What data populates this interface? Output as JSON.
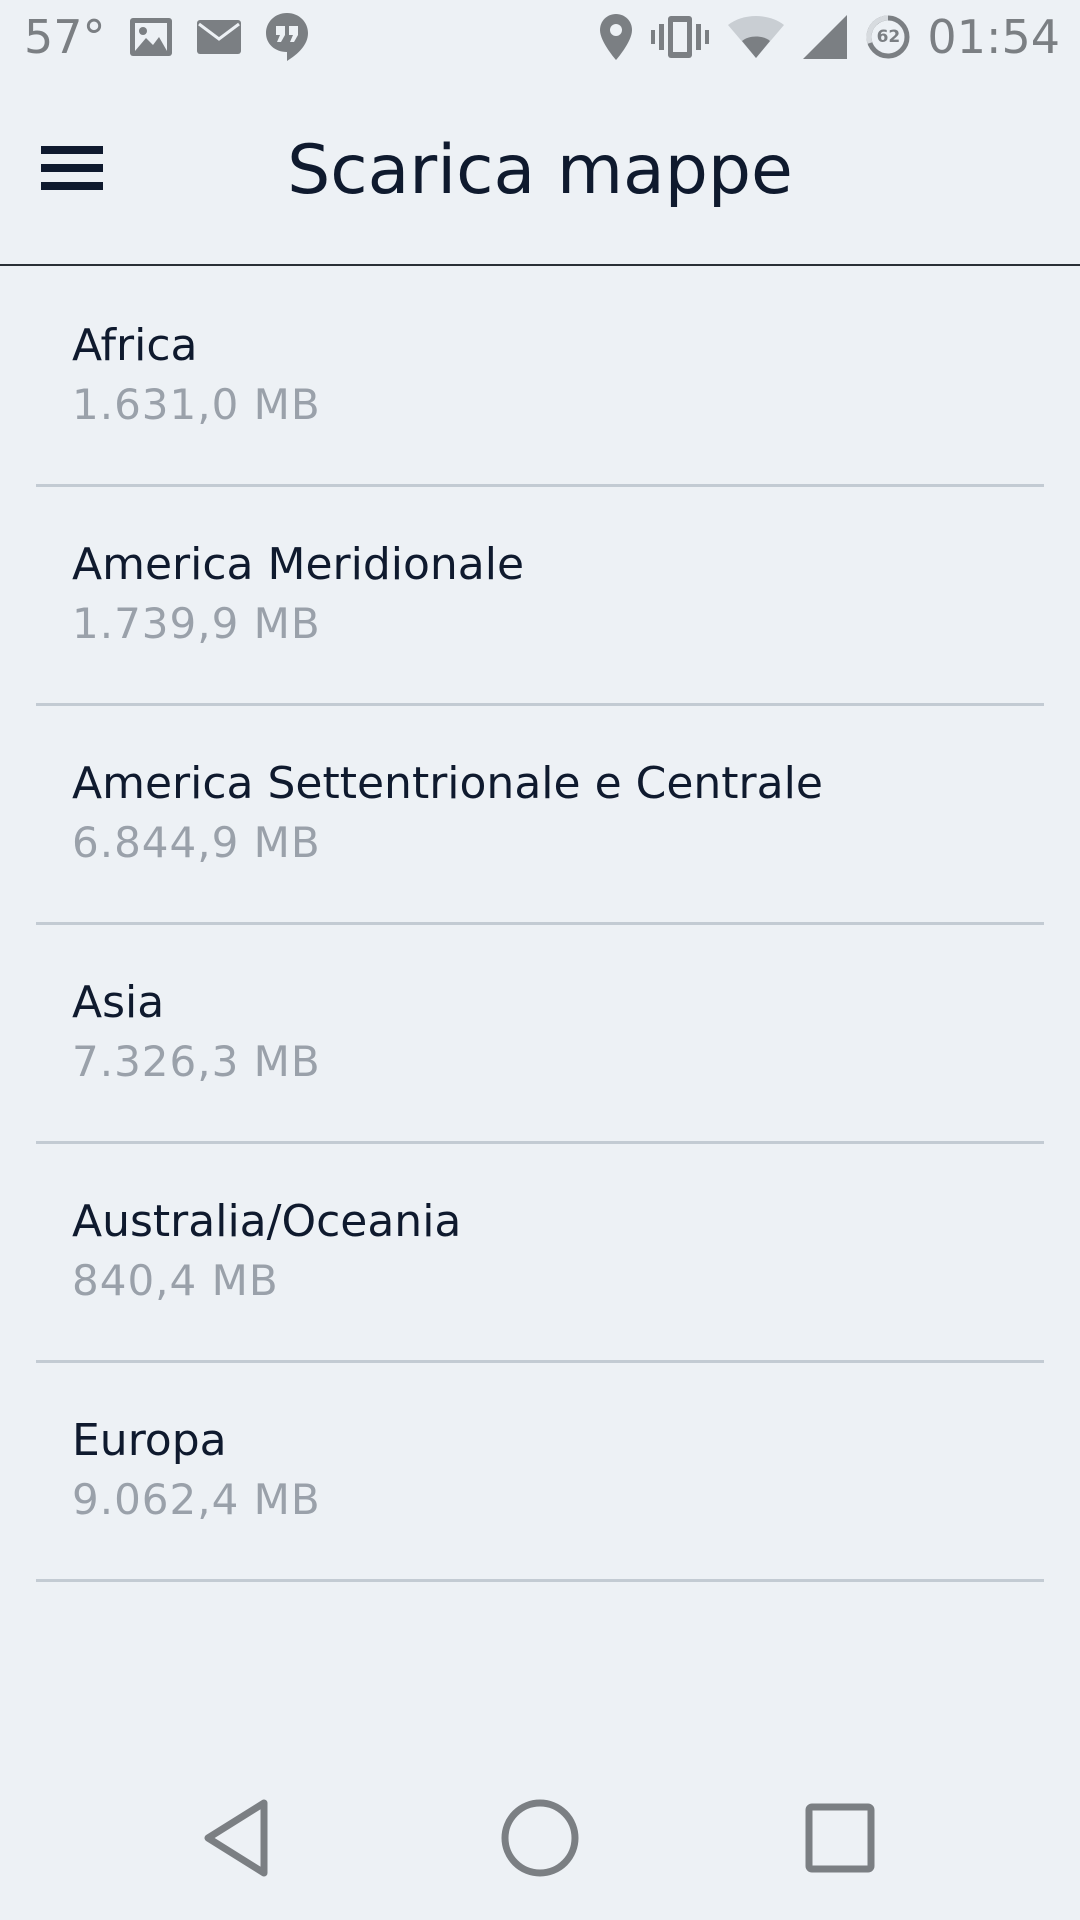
{
  "status_bar": {
    "temperature": "57°",
    "time": "01:54",
    "battery_level": "62",
    "left_icons": [
      "image-icon",
      "mail-icon",
      "hangouts-icon"
    ],
    "right_icons": [
      "location-icon",
      "vibrate-icon",
      "wifi-icon",
      "cell-signal-icon",
      "battery-icon"
    ]
  },
  "app_bar": {
    "title": "Scarica mappe",
    "menu_icon": "hamburger-menu-icon"
  },
  "regions": [
    {
      "name": "Africa",
      "size": "1.631,0 MB"
    },
    {
      "name": "America Meridionale",
      "size": "1.739,9 MB"
    },
    {
      "name": "America Settentrionale e Centrale",
      "size": "6.844,9 MB"
    },
    {
      "name": "Asia",
      "size": "7.326,3 MB"
    },
    {
      "name": "Australia/Oceania",
      "size": "840,4 MB"
    },
    {
      "name": "Europa",
      "size": "9.062,4 MB"
    }
  ],
  "nav_bar": {
    "icons": [
      "back-icon",
      "home-icon",
      "recents-icon"
    ]
  },
  "colors": {
    "background": "#edf1f5",
    "title_text": "#0f1a2e",
    "secondary_text": "#9aa1aa",
    "divider": "#c3cbd3",
    "status_icons": "#7b7f83"
  }
}
